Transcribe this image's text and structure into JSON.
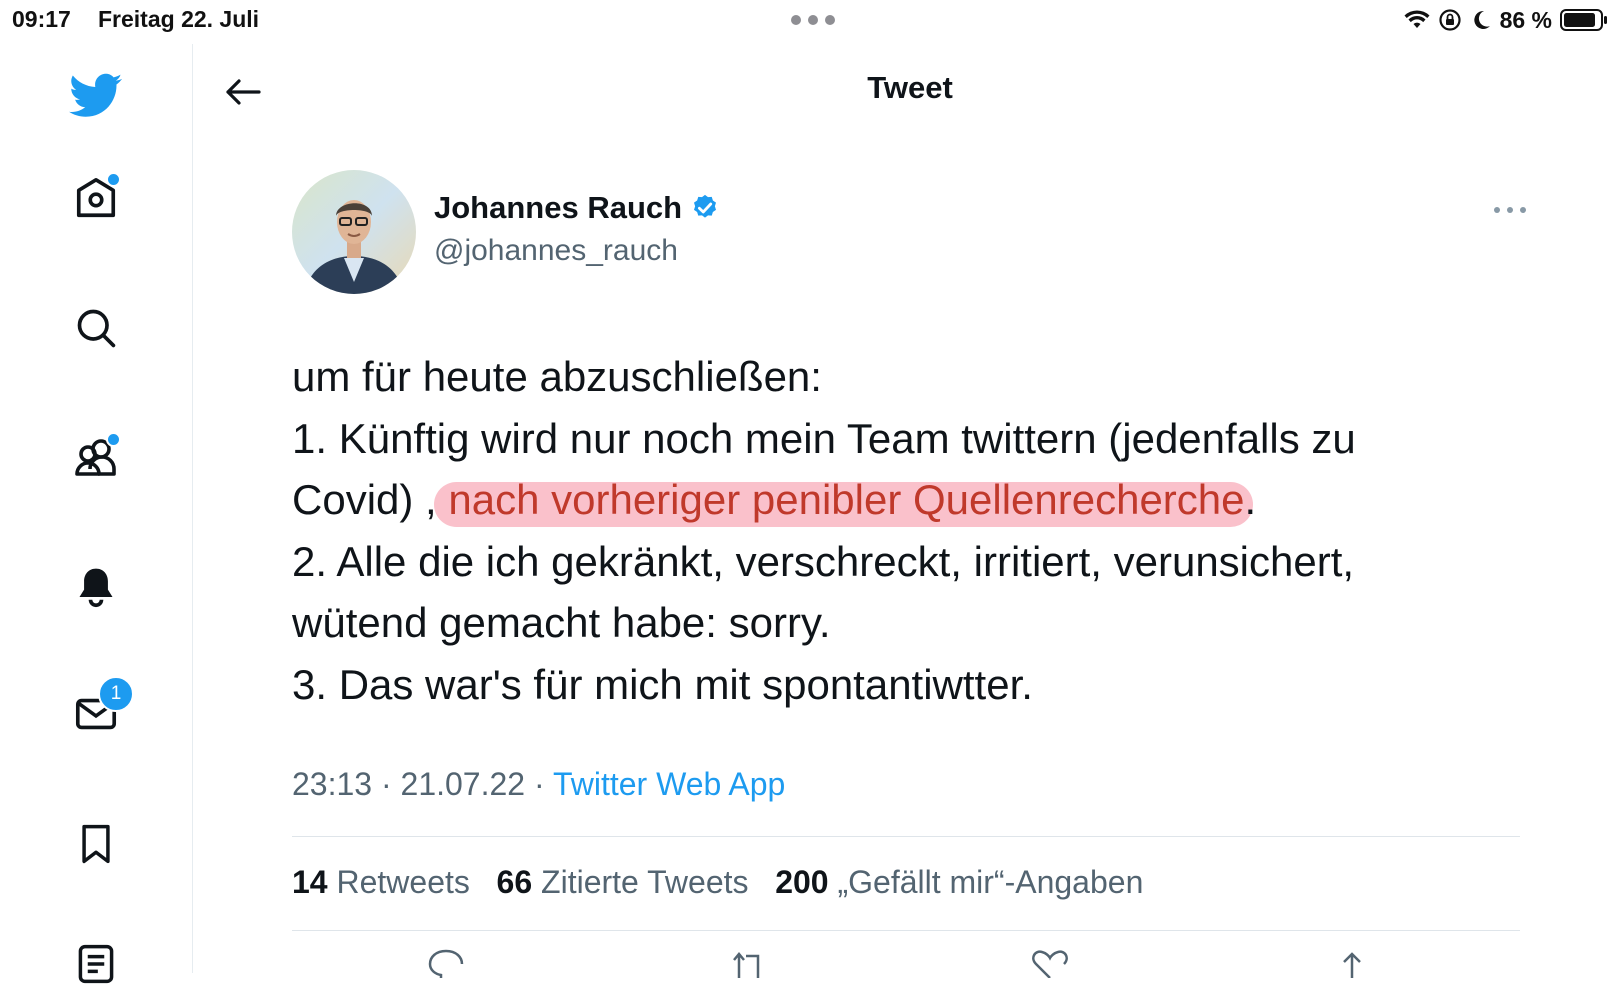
{
  "status_bar": {
    "time": "09:17",
    "date": "Freitag 22. Juli",
    "battery": "86 %",
    "icons": [
      "wifi-icon",
      "orientation-lock-icon",
      "moon-icon",
      "battery-icon"
    ]
  },
  "sidebar": {
    "items": [
      {
        "name": "twitter-logo",
        "icon": "twitter-bird-icon"
      },
      {
        "name": "home",
        "icon": "home-icon",
        "dot": true
      },
      {
        "name": "explore",
        "icon": "search-icon"
      },
      {
        "name": "communities",
        "icon": "people-icon",
        "dot": true
      },
      {
        "name": "notifications",
        "icon": "bell-icon"
      },
      {
        "name": "messages",
        "icon": "mail-icon",
        "badge": "1"
      },
      {
        "name": "bookmarks",
        "icon": "bookmark-icon"
      },
      {
        "name": "lists",
        "icon": "list-icon"
      }
    ]
  },
  "header": {
    "title": "Tweet",
    "back_icon": "arrow-left-icon"
  },
  "tweet": {
    "author_name": "Johannes Rauch",
    "verified_icon": "verified-badge-icon",
    "handle": "@johannes_rauch",
    "more_icon": "more-horizontal-icon",
    "text": {
      "line1": "um  für heute abzuschließen:",
      "line2": "1. Künftig wird nur noch mein Team twittern (jedenfalls zu",
      "line3_before": "Covid) , ",
      "line3_highlight": "nach vorheriger penibler Quellenrecherche",
      "line3_after": ".",
      "line4": "2. Alle die ich gekränkt, verschreckt, irritiert, verunsichert,",
      "line5": "wütend gemacht habe: sorry.",
      "line6": "3. Das war's für mich mit  spontantiwtter."
    },
    "timestamp": "23:13 · 21.07.22 · ",
    "source": "Twitter Web App",
    "stats": {
      "retweets_count": "14",
      "retweets_label": "Retweets",
      "quotes_count": "66",
      "quotes_label": "Zitierte Tweets",
      "likes_count": "200",
      "likes_label": "„Gefällt mir“-Angaben"
    },
    "actions": [
      "reply-icon",
      "retweet-icon",
      "like-icon",
      "share-icon"
    ]
  },
  "colors": {
    "accent": "#1d9bf0",
    "text": "#0f1419",
    "secondary": "#536471",
    "highlight": "#f46c82"
  }
}
